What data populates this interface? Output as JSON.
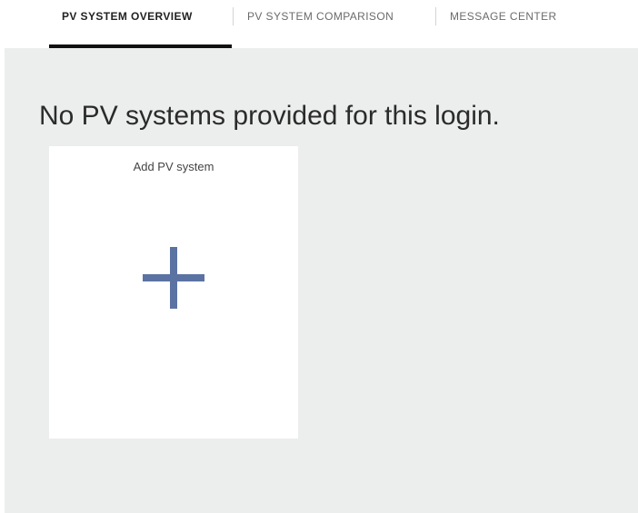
{
  "tabs": [
    {
      "label": "PV SYSTEM OVERVIEW",
      "active": true
    },
    {
      "label": "PV SYSTEM COMPARISON",
      "active": false
    },
    {
      "label": "MESSAGE CENTER",
      "active": false
    }
  ],
  "main": {
    "empty_message": "No PV systems provided for this login.",
    "add_card": {
      "title": "Add PV system",
      "icon": "plus-icon",
      "icon_color": "#5b73a3"
    }
  },
  "colors": {
    "content_background": "#eceeed",
    "active_tab_indicator": "#111111"
  }
}
